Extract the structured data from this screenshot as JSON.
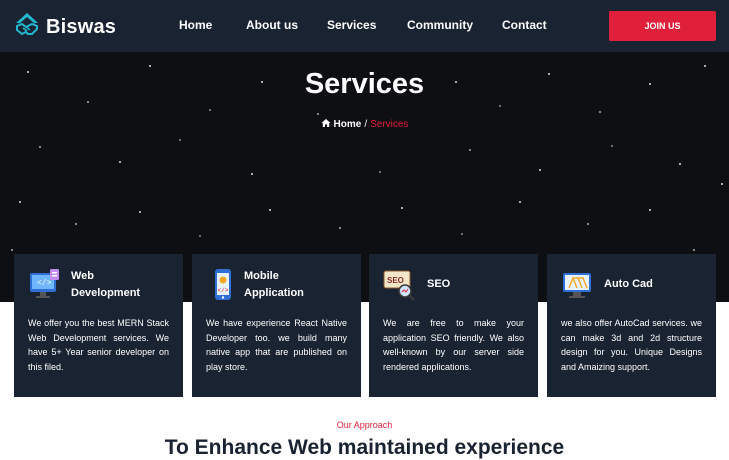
{
  "brand": {
    "name": "Biswas",
    "logo_icon": "handshake-icon"
  },
  "nav": {
    "items": [
      "Home",
      "About us",
      "Services",
      "Community",
      "Contact"
    ],
    "cta": "JOIN US"
  },
  "hero": {
    "title": "Services",
    "breadcrumb": {
      "home": "Home",
      "separator": "/",
      "current": "Services"
    }
  },
  "cards": [
    {
      "title_line1": "Web",
      "title_line2": "Development",
      "icon": "monitor-code-icon",
      "text": "We offer you the best MERN Stack Web Development services. We have 5+ Year senior developer on this filed."
    },
    {
      "title_line1": "Mobile",
      "title_line2": "Application",
      "icon": "mobile-app-icon",
      "text": "We have experience React Native Developer too. we build many native app that are published on play store."
    },
    {
      "title_line1": "SEO",
      "title_line2": "",
      "icon": "seo-magnifier-icon",
      "text": "We are free to make your application SEO friendly. We also well-known by our server side rendered applications."
    },
    {
      "title_line1": "Auto Cad",
      "title_line2": "",
      "icon": "autocad-monitor-icon",
      "text": "we also offer AutoCad services. we can make 3d and 2d structure design for you. Unique Designs and Amaizing support."
    }
  ],
  "section": {
    "eyebrow": "Our Approach",
    "headline": "To Enhance Web maintained experience"
  },
  "colors": {
    "nav_bg": "#1a2332",
    "accent": "#e0203a",
    "hero_bg": "#0e0f13",
    "brand_teal": "#22b8cf"
  }
}
